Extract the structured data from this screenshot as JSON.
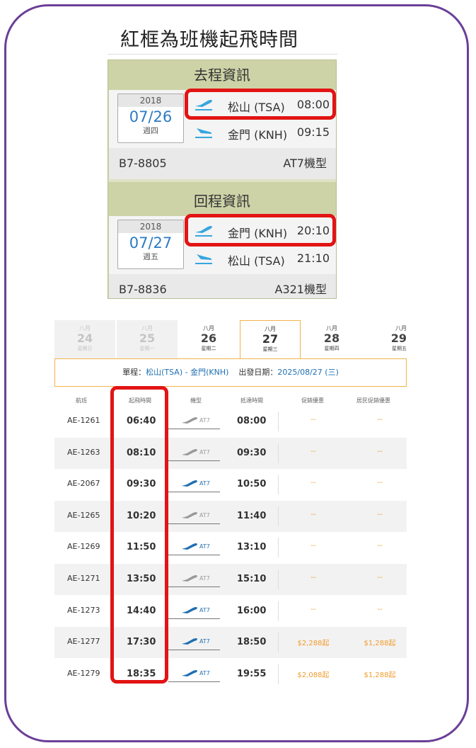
{
  "heading": "紅框為班機起飛時間",
  "outbound": {
    "header": "去程資訊",
    "year": "2018",
    "date": "07/26",
    "weekday": "週四",
    "depart_airport": "松山 (TSA)",
    "depart_time": "08:00",
    "arrive_airport": "金門 (KNH)",
    "arrive_time": "09:15",
    "flight_no": "B7-8805",
    "aircraft": "AT7機型"
  },
  "return": {
    "header": "回程資訊",
    "year": "2018",
    "date": "07/27",
    "weekday": "週五",
    "depart_airport": "金門 (KNH)",
    "depart_time": "20:10",
    "arrive_airport": "松山 (TSA)",
    "arrive_time": "21:10",
    "flight_no": "B7-8836",
    "aircraft": "A321機型"
  },
  "date_tabs": [
    {
      "month": "八月",
      "day": "24",
      "weekday": "星期日"
    },
    {
      "month": "八月",
      "day": "25",
      "weekday": "星期一"
    },
    {
      "month": "八月",
      "day": "26",
      "weekday": "星期二"
    },
    {
      "month": "八月",
      "day": "27",
      "weekday": "星期三"
    },
    {
      "month": "八月",
      "day": "28",
      "weekday": "星期四"
    },
    {
      "month": "八月",
      "day": "29",
      "weekday": "星期五"
    }
  ],
  "route_bar": {
    "route_label": "單程：",
    "route_value": "松山(TSA) - 金門(KNH)",
    "date_label": "出發日期：",
    "date_value": "2025/08/27 (三)"
  },
  "columns": [
    "航班",
    "起飛時間",
    "機型",
    "抵達時間",
    "促銷優惠",
    "居民促銷優惠"
  ],
  "flights": [
    {
      "flight": "AE-1261",
      "dep": "06:40",
      "aircraft": "AT7",
      "arr": "08:00",
      "promo": "--",
      "resident": "--",
      "plane_color": "#999999"
    },
    {
      "flight": "AE-1263",
      "dep": "08:10",
      "aircraft": "AT7",
      "arr": "09:30",
      "promo": "--",
      "resident": "--",
      "plane_color": "#999999"
    },
    {
      "flight": "AE-2067",
      "dep": "09:30",
      "aircraft": "AT7",
      "arr": "10:50",
      "promo": "--",
      "resident": "--",
      "plane_color": "#1f6fb2"
    },
    {
      "flight": "AE-1265",
      "dep": "10:20",
      "aircraft": "AT7",
      "arr": "11:40",
      "promo": "--",
      "resident": "--",
      "plane_color": "#999999"
    },
    {
      "flight": "AE-1269",
      "dep": "11:50",
      "aircraft": "AT7",
      "arr": "13:10",
      "promo": "--",
      "resident": "--",
      "plane_color": "#1f6fb2"
    },
    {
      "flight": "AE-1271",
      "dep": "13:50",
      "aircraft": "AT7",
      "arr": "15:10",
      "promo": "--",
      "resident": "--",
      "plane_color": "#999999"
    },
    {
      "flight": "AE-1273",
      "dep": "14:40",
      "aircraft": "AT7",
      "arr": "16:00",
      "promo": "--",
      "resident": "--",
      "plane_color": "#1f6fb2"
    },
    {
      "flight": "AE-1277",
      "dep": "17:30",
      "aircraft": "AT7",
      "arr": "18:50",
      "promo": "$2,288起",
      "resident": "$1,288起",
      "plane_color": "#1f6fb2"
    },
    {
      "flight": "AE-1279",
      "dep": "18:35",
      "aircraft": "AT7",
      "arr": "19:55",
      "promo": "$2,088起",
      "resident": "$1,288起",
      "plane_color": "#1f6fb2"
    }
  ],
  "colors": {
    "frame": "#6a3f97",
    "highlight": "#e21414",
    "accent": "#f2b34a",
    "card": "#cdd3a7"
  }
}
